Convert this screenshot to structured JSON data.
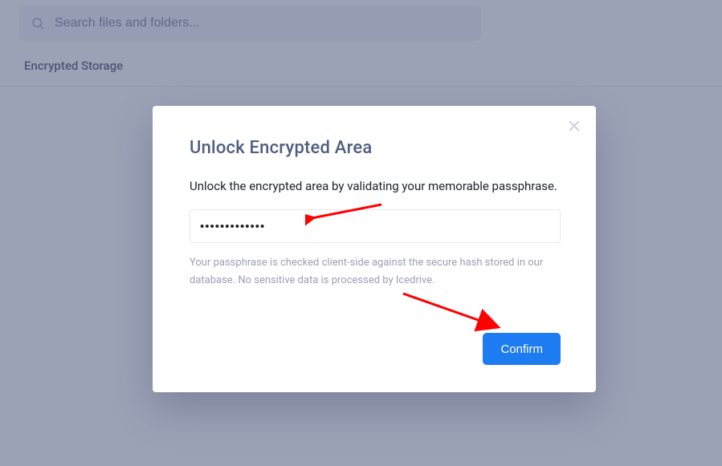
{
  "search": {
    "placeholder": "Search files and folders..."
  },
  "page": {
    "heading": "Encrypted Storage"
  },
  "modal": {
    "title": "Unlock Encrypted Area",
    "subtitle": "Unlock the encrypted area by validating your memorable passphrase.",
    "passphrase_value": "•••••••••••••",
    "help_text": "Your passphrase is checked client-side against the secure hash stored in our database. No sensitive data is processed by Icedrive.",
    "confirm_label": "Confirm"
  },
  "colors": {
    "accent": "#1d7cf2",
    "arrow": "#ff0000"
  }
}
